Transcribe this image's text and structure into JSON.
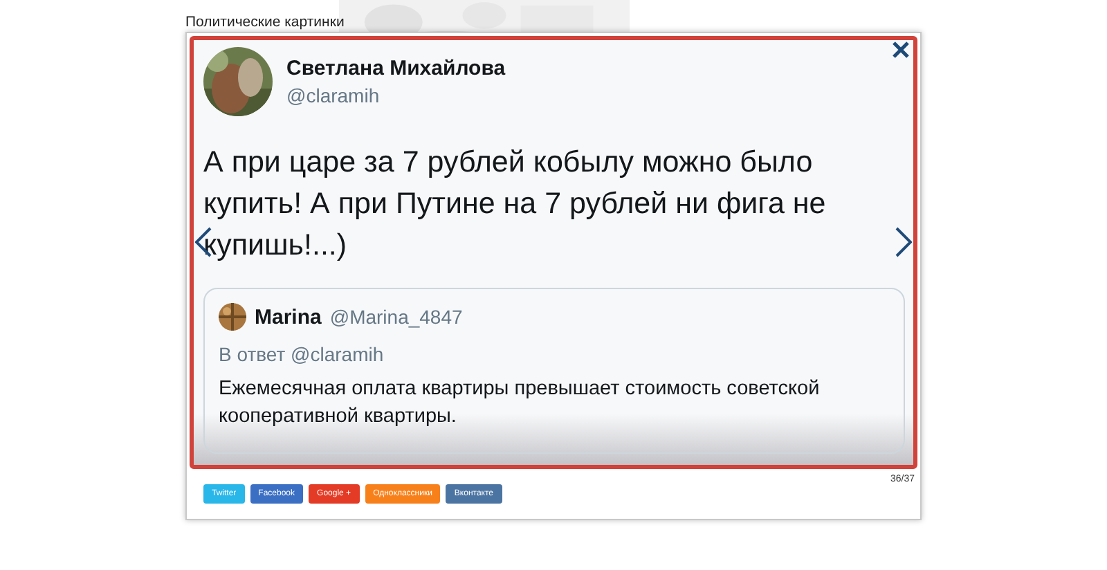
{
  "page": {
    "title": "Политические картинки"
  },
  "lightbox": {
    "counter": "36/37",
    "tweet": {
      "author": "Светлана Михайлова",
      "handle": "@claramih",
      "text": "А при царе за 7 рублей кобылу можно было купить! А при Путине на 7 рублей ни фига не купишь!...)",
      "quote": {
        "author": "Marina",
        "handle": "@Marina_4847",
        "reply_to": "В ответ @claramih",
        "text": "Ежемесячная оплата квартиры превышает стоимость советской кооперативной квартиры."
      }
    },
    "share_buttons": [
      {
        "label": "Twitter",
        "color": "#29b6e9"
      },
      {
        "label": "Facebook",
        "color": "#3b6fc4"
      },
      {
        "label": "Google +",
        "color": "#e33b25"
      },
      {
        "label": "Одноклассники",
        "color": "#f8801a"
      },
      {
        "label": "Вконтакте",
        "color": "#4c74a2"
      }
    ]
  }
}
